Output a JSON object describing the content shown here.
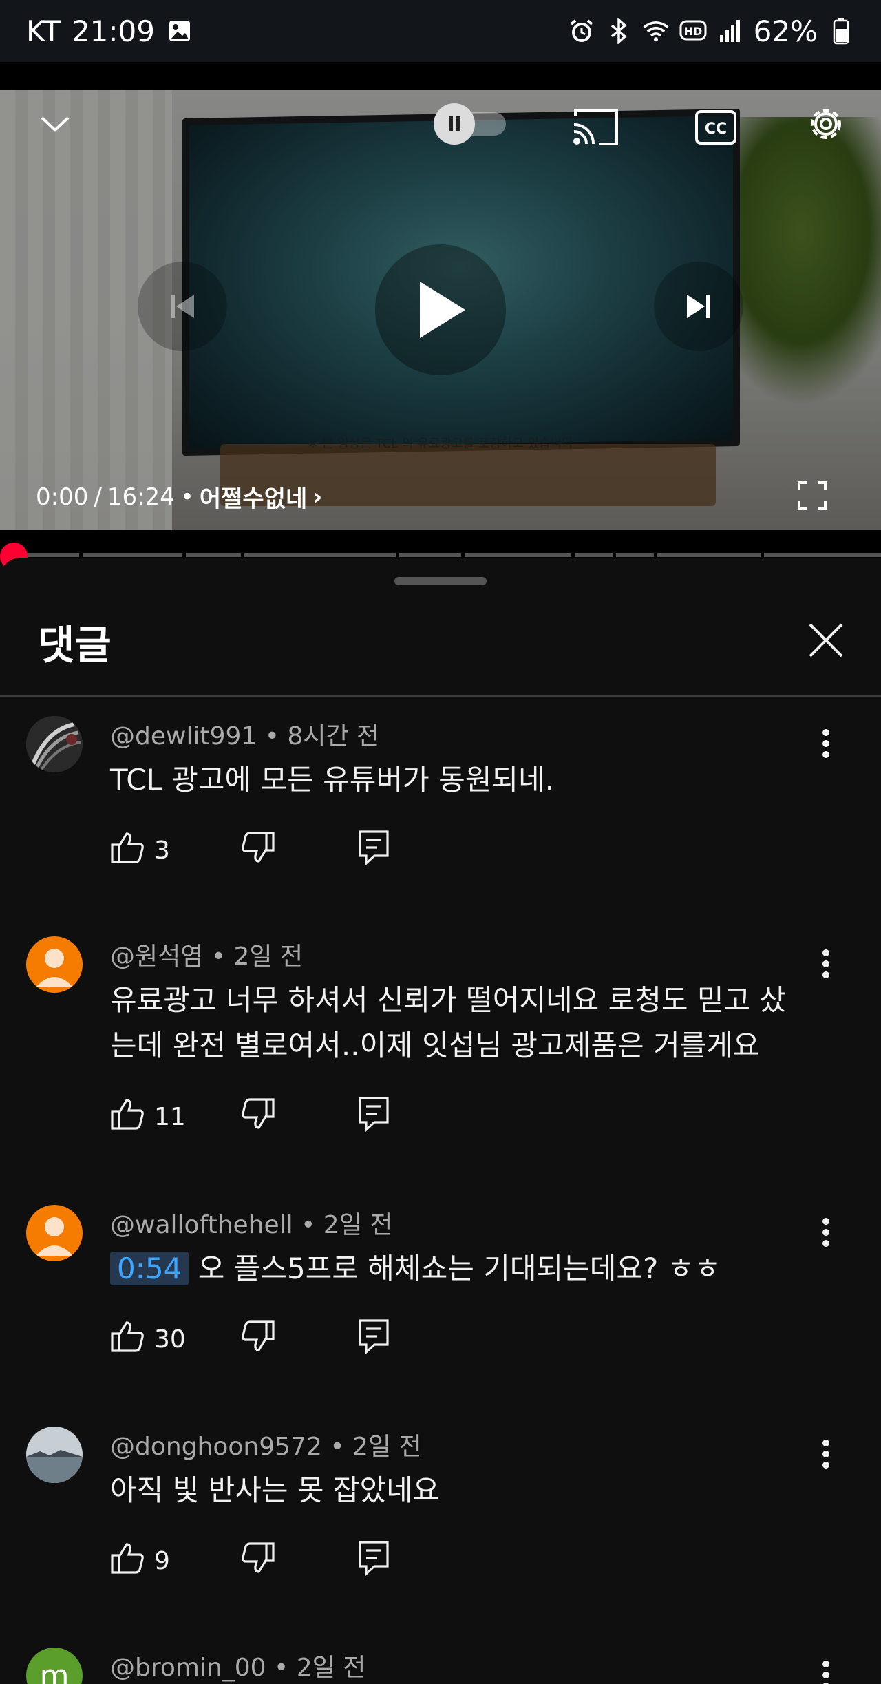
{
  "status_bar": {
    "carrier": "KT",
    "time": "21:09",
    "battery": "62%"
  },
  "player": {
    "sponsor_notice": "※ 본 영상은 TCL 의 유료광고를 포함하고 있습니다",
    "current_time": "0:00",
    "duration": "16:24",
    "separator": "/",
    "chapter_dot": "•",
    "chapter": "어쩔수없네",
    "chapter_chevron": "›",
    "progress_fraction": 0.0
  },
  "comments_panel": {
    "title": "댓글",
    "comments": [
      {
        "author": "@dewlit991",
        "time": "8시간 전",
        "text": "TCL 광고에 모든 유튜버가 동원되네.",
        "likes": "3",
        "avatar_letter": "",
        "avatar_color": "#3a3a3a"
      },
      {
        "author": "@원석염",
        "time": "2일 전",
        "text": "유료광고 너무 하셔서 신뢰가 떨어지네요 로청도 믿고 샀는데 완전 별로여서..이제 잇섭님 광고제품은 거를게요",
        "likes": "11",
        "avatar_letter": "",
        "avatar_color": "#f57c00"
      },
      {
        "author": "@wallofthehell",
        "time": "2일 전",
        "timestamp_link": "0:54",
        "text": "오 플스5프로 해체쇼는 기대되는데요? ㅎㅎ",
        "likes": "30",
        "avatar_letter": "",
        "avatar_color": "#f57c00"
      },
      {
        "author": "@donghoon9572",
        "time": "2일 전",
        "text": "아직 빛 반사는 못 잡았네요",
        "likes": "9",
        "avatar_letter": "",
        "avatar_color": "#7d8a95"
      },
      {
        "author": "@bromin_00",
        "time": "2일 전",
        "text": "",
        "likes": "",
        "avatar_letter": "m",
        "avatar_color": "#5c9e2c"
      }
    ]
  },
  "colors": {
    "background": "#0f0f0f",
    "accent_red": "#ff0033",
    "link_blue": "#3ea6ff",
    "secondary_text": "#aaaaaa"
  }
}
